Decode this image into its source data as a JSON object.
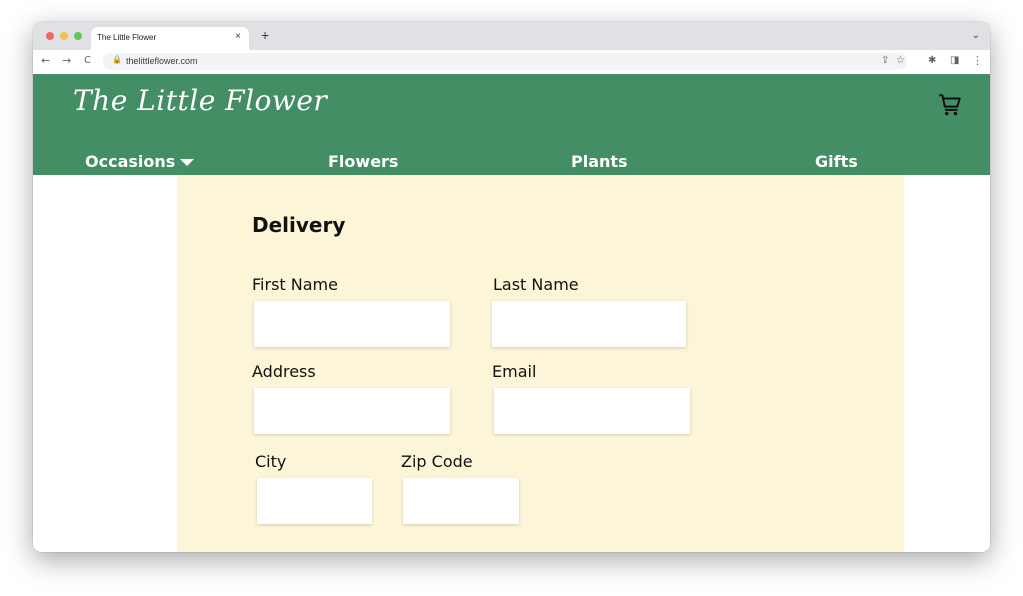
{
  "browser": {
    "tab_title": "The Little Flower",
    "tab_close": "×",
    "new_tab": "+",
    "tab_menu": "⌄",
    "back": "←",
    "forward": "→",
    "reload": "C",
    "lock": "🔒",
    "url": "thelittleflower.com",
    "share": "⇪",
    "bookmark": "☆",
    "extensions": "✱",
    "sidepanel": "◨",
    "menu": "⋮"
  },
  "site": {
    "logo": "The Little Flower",
    "brand_color": "#438e64",
    "content_bg": "#fdf5d7",
    "nav": {
      "occasions": "Occasions",
      "flowers": "Flowers",
      "plants": "Plants",
      "gifts": "Gifts"
    }
  },
  "form": {
    "heading": "Delivery",
    "first_name": {
      "label": "First Name",
      "value": ""
    },
    "last_name": {
      "label": "Last Name",
      "value": ""
    },
    "address": {
      "label": "Address",
      "value": ""
    },
    "email": {
      "label": "Email",
      "value": ""
    },
    "city": {
      "label": "City",
      "value": ""
    },
    "zip": {
      "label": "Zip Code",
      "value": ""
    }
  }
}
